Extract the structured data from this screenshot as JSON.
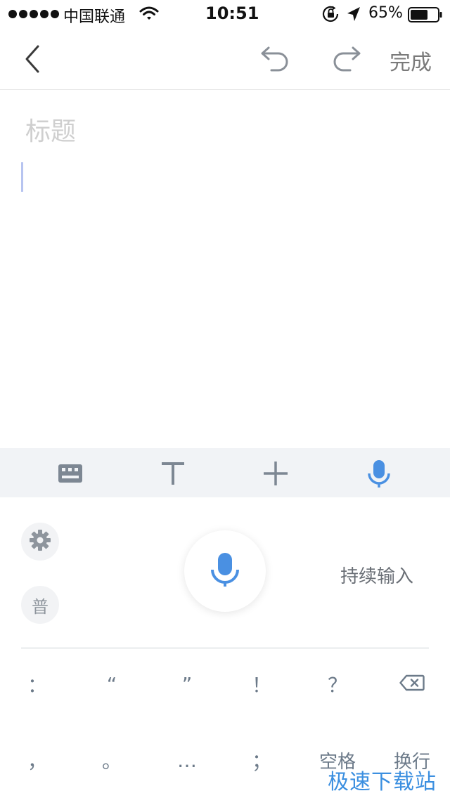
{
  "status_bar": {
    "carrier": "中国联通",
    "time": "10:51",
    "battery_percent": "65%",
    "battery_level": 0.65,
    "icons": [
      "wifi-icon",
      "rotation-lock-icon",
      "location-arrow-icon",
      "battery-icon"
    ]
  },
  "nav": {
    "back_icon": "chevron-left-icon",
    "undo_icon": "undo-icon",
    "redo_icon": "redo-icon",
    "done_label": "完成"
  },
  "editor": {
    "title_placeholder": "标题"
  },
  "toolbar": {
    "items": [
      "keyboard-icon",
      "text-format-icon",
      "plus-icon",
      "microphone-icon"
    ],
    "active_item": "microphone-icon",
    "active_color": "#4a90e2"
  },
  "voice_panel": {
    "settings_icon": "gear-icon",
    "mandarin_label": "普",
    "mic_icon": "microphone-icon",
    "continuous_input_label": "持续输入",
    "keys_row1": [
      "：",
      "“",
      "”",
      "！",
      "？"
    ],
    "delete_icon": "backspace-icon",
    "keys_row2": [
      "，",
      "。",
      "…",
      "；"
    ],
    "space_label": "空格",
    "newline_label": "换行"
  },
  "watermark": "极速下载站",
  "colors": {
    "accent": "#4a90e2",
    "toolbar_bg": "#f1f3f6",
    "icon_gray": "#7d8793"
  }
}
